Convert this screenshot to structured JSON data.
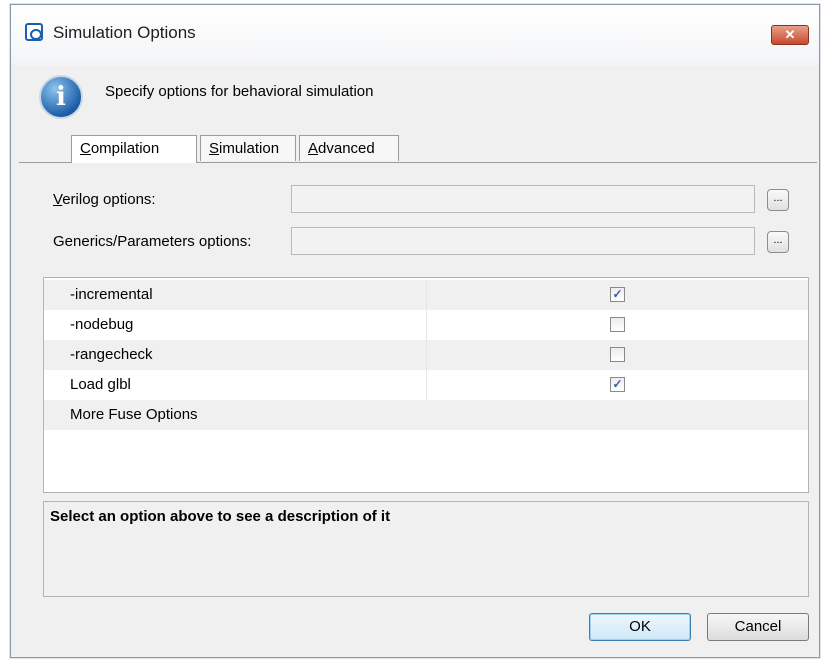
{
  "window": {
    "title": "Simulation Options",
    "close_label": "✕"
  },
  "header": {
    "message": "Specify options for behavioral simulation",
    "icon": "info-icon"
  },
  "tabs": [
    {
      "label": "Compilation",
      "underline": "C",
      "active": true
    },
    {
      "label": "Simulation",
      "underline": "S",
      "active": false
    },
    {
      "label": "Advanced",
      "underline": "A",
      "active": false
    }
  ],
  "form": {
    "verilog_label": "Verilog options:",
    "verilog_value": "",
    "generics_label": "Generics/Parameters options:",
    "generics_value": "",
    "browse_label": "..."
  },
  "options": [
    {
      "name": "-incremental",
      "checked": true
    },
    {
      "name": "-nodebug",
      "checked": false
    },
    {
      "name": "-rangecheck",
      "checked": false
    },
    {
      "name": "Load glbl",
      "checked": true
    },
    {
      "name": "More Fuse Options",
      "checked": null
    }
  ],
  "description": {
    "text": "Select an option above to see a description of it"
  },
  "buttons": {
    "ok": "OK",
    "cancel": "Cancel"
  }
}
